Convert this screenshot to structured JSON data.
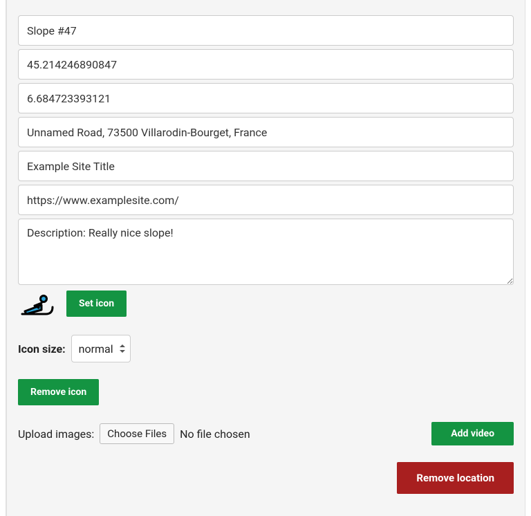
{
  "fields": {
    "name": "Slope #47",
    "lat": "45.214246890847",
    "lng": "6.684723393121",
    "address": "Unnamed Road, 73500 Villarodin-Bourget, France",
    "site_title": "Example Site Title",
    "site_url": "https://www.examplesite.com/",
    "description": "Description: Really nice slope!"
  },
  "icon": {
    "name": "sled-icon",
    "set_button": "Set icon",
    "size_label": "Icon size:",
    "size_value": "normal",
    "remove_button": "Remove icon"
  },
  "upload": {
    "label": "Upload images:",
    "choose_button": "Choose Files",
    "status": "No file chosen",
    "add_video_button": "Add video"
  },
  "remove_location_button": "Remove location"
}
